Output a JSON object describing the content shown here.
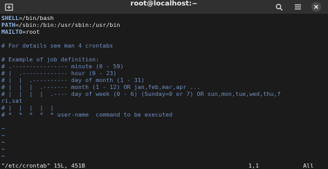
{
  "window": {
    "title": "root@localhost:~"
  },
  "terminal": {
    "lines": [
      {
        "var": "SHELL",
        "eq": "=",
        "val": "/bin/bash"
      },
      {
        "var": "PATH",
        "eq": "=",
        "val": "/sbin:/bin:/usr/sbin:/usr/bin"
      },
      {
        "var": "MAILTO",
        "eq": "=",
        "val": "root"
      }
    ],
    "comments": [
      "# For details see man 4 crontabs",
      "# Example of job definition:",
      "# .---------------- minute (0 - 59)",
      "# |  .------------- hour (0 - 23)",
      "# |  |  .---------- day of month (1 - 31)",
      "# |  |  |  .------- month (1 - 12) OR jan,feb,mar,apr ...",
      "# |  |  |  |  .---- day of week (0 - 6) (Sunday=0 or 7) OR sun,mon,tue,wed,thu,f",
      "ri,sat",
      "# |  |  |  |  |",
      "# *  *  *  *  * user-name  command to be executed"
    ],
    "tilde": "~",
    "status_file": "\"/etc/crontab\" 15L, 451B",
    "status_pos": "1,1",
    "status_scroll": "All"
  },
  "icons": {
    "new_tab": "new-tab-icon",
    "search": "search-icon",
    "menu": "hamburger-menu-icon",
    "close": "close-icon"
  }
}
